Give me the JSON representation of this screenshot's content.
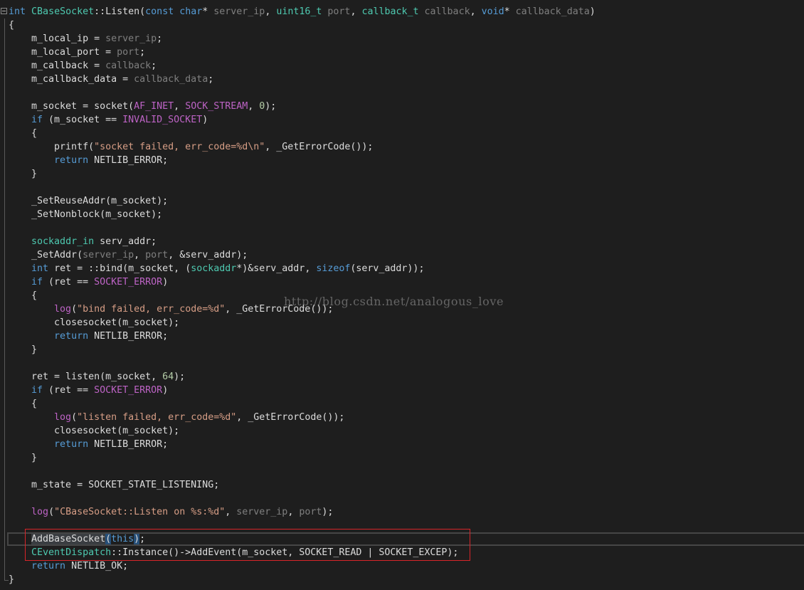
{
  "colors": {
    "background": "#1e1e1e",
    "default": "#dcdcdc",
    "keyword": "#569cd6",
    "type": "#4ec9b0",
    "macro": "#bd63c5",
    "string": "#d69d85",
    "parameter": "#7f7f7f",
    "number": "#b5cea8",
    "highlight_border": "#d8252a"
  },
  "editor": {
    "fold_icon": "collapse-icon",
    "watermark": "http://blog.csdn.net/analogous_love",
    "lines": [
      [
        {
          "t": "int",
          "c": "keyword"
        },
        {
          "t": " "
        },
        {
          "t": "CBaseSocket",
          "c": "type"
        },
        {
          "t": "::Listen("
        },
        {
          "t": "const",
          "c": "keyword"
        },
        {
          "t": " "
        },
        {
          "t": "char",
          "c": "keyword"
        },
        {
          "t": "* "
        },
        {
          "t": "server_ip",
          "c": "parameter"
        },
        {
          "t": ", "
        },
        {
          "t": "uint16_t",
          "c": "type"
        },
        {
          "t": " "
        },
        {
          "t": "port",
          "c": "parameter"
        },
        {
          "t": ", "
        },
        {
          "t": "callback_t",
          "c": "type"
        },
        {
          "t": " "
        },
        {
          "t": "callback",
          "c": "parameter"
        },
        {
          "t": ", "
        },
        {
          "t": "void",
          "c": "keyword"
        },
        {
          "t": "* "
        },
        {
          "t": "callback_data",
          "c": "parameter"
        },
        {
          "t": ")"
        }
      ],
      [
        {
          "t": "{"
        }
      ],
      [
        {
          "t": "    m_local_ip = "
        },
        {
          "t": "server_ip",
          "c": "parameter"
        },
        {
          "t": ";"
        }
      ],
      [
        {
          "t": "    m_local_port = "
        },
        {
          "t": "port",
          "c": "parameter"
        },
        {
          "t": ";"
        }
      ],
      [
        {
          "t": "    m_callback = "
        },
        {
          "t": "callback",
          "c": "parameter"
        },
        {
          "t": ";"
        }
      ],
      [
        {
          "t": "    m_callback_data = "
        },
        {
          "t": "callback_data",
          "c": "parameter"
        },
        {
          "t": ";"
        }
      ],
      [],
      [
        {
          "t": "    m_socket = socket("
        },
        {
          "t": "AF_INET",
          "c": "macro"
        },
        {
          "t": ", "
        },
        {
          "t": "SOCK_STREAM",
          "c": "macro"
        },
        {
          "t": ", "
        },
        {
          "t": "0",
          "c": "number"
        },
        {
          "t": ");"
        }
      ],
      [
        {
          "t": "    "
        },
        {
          "t": "if",
          "c": "keyword"
        },
        {
          "t": " (m_socket == "
        },
        {
          "t": "INVALID_SOCKET",
          "c": "macro"
        },
        {
          "t": ")"
        }
      ],
      [
        {
          "t": "    {"
        }
      ],
      [
        {
          "t": "        printf("
        },
        {
          "t": "\"socket failed, err_code=%d\\n\"",
          "c": "string"
        },
        {
          "t": ", _GetErrorCode());"
        }
      ],
      [
        {
          "t": "        "
        },
        {
          "t": "return",
          "c": "keyword"
        },
        {
          "t": " NETLIB_ERROR;"
        }
      ],
      [
        {
          "t": "    }"
        }
      ],
      [],
      [
        {
          "t": "    _SetReuseAddr(m_socket);"
        }
      ],
      [
        {
          "t": "    _SetNonblock(m_socket);"
        }
      ],
      [],
      [
        {
          "t": "    "
        },
        {
          "t": "sockaddr_in",
          "c": "type"
        },
        {
          "t": " serv_addr;"
        }
      ],
      [
        {
          "t": "    _SetAddr("
        },
        {
          "t": "server_ip",
          "c": "parameter"
        },
        {
          "t": ", "
        },
        {
          "t": "port",
          "c": "parameter"
        },
        {
          "t": ", &serv_addr);"
        }
      ],
      [
        {
          "t": "    "
        },
        {
          "t": "int",
          "c": "keyword"
        },
        {
          "t": " ret = ::bind(m_socket, ("
        },
        {
          "t": "sockaddr",
          "c": "type"
        },
        {
          "t": "*)&serv_addr, "
        },
        {
          "t": "sizeof",
          "c": "keyword"
        },
        {
          "t": "(serv_addr));"
        }
      ],
      [
        {
          "t": "    "
        },
        {
          "t": "if",
          "c": "keyword"
        },
        {
          "t": " (ret == "
        },
        {
          "t": "SOCKET_ERROR",
          "c": "macro"
        },
        {
          "t": ")"
        }
      ],
      [
        {
          "t": "    {"
        }
      ],
      [
        {
          "t": "        "
        },
        {
          "t": "log",
          "c": "macro"
        },
        {
          "t": "("
        },
        {
          "t": "\"bind failed, err_code=%d\"",
          "c": "string"
        },
        {
          "t": ", _GetErrorCode());"
        }
      ],
      [
        {
          "t": "        closesocket(m_socket);"
        }
      ],
      [
        {
          "t": "        "
        },
        {
          "t": "return",
          "c": "keyword"
        },
        {
          "t": " NETLIB_ERROR;"
        }
      ],
      [
        {
          "t": "    }"
        }
      ],
      [],
      [
        {
          "t": "    ret = listen(m_socket, "
        },
        {
          "t": "64",
          "c": "number"
        },
        {
          "t": ");"
        }
      ],
      [
        {
          "t": "    "
        },
        {
          "t": "if",
          "c": "keyword"
        },
        {
          "t": " (ret == "
        },
        {
          "t": "SOCKET_ERROR",
          "c": "macro"
        },
        {
          "t": ")"
        }
      ],
      [
        {
          "t": "    {"
        }
      ],
      [
        {
          "t": "        "
        },
        {
          "t": "log",
          "c": "macro"
        },
        {
          "t": "("
        },
        {
          "t": "\"listen failed, err_code=%d\"",
          "c": "string"
        },
        {
          "t": ", _GetErrorCode());"
        }
      ],
      [
        {
          "t": "        closesocket(m_socket);"
        }
      ],
      [
        {
          "t": "        "
        },
        {
          "t": "return",
          "c": "keyword"
        },
        {
          "t": " NETLIB_ERROR;"
        }
      ],
      [
        {
          "t": "    }"
        }
      ],
      [],
      [
        {
          "t": "    m_state = SOCKET_STATE_LISTENING;"
        }
      ],
      [],
      [
        {
          "t": "    "
        },
        {
          "t": "log",
          "c": "macro"
        },
        {
          "t": "("
        },
        {
          "t": "\"CBaseSocket::Listen on %s:%d\"",
          "c": "string"
        },
        {
          "t": ", "
        },
        {
          "t": "server_ip",
          "c": "parameter"
        },
        {
          "t": ", "
        },
        {
          "t": "port",
          "c": "parameter"
        },
        {
          "t": ");"
        }
      ],
      [],
      [
        {
          "t": "    "
        },
        {
          "t": "AddBaseSocket",
          "s": "hl"
        },
        {
          "t": "(",
          "s": "sel"
        },
        {
          "t": "this",
          "c": "keyword"
        },
        {
          "t": ")",
          "s": "sel"
        },
        {
          "t": ";"
        }
      ],
      [
        {
          "t": "    "
        },
        {
          "t": "CEventDispatch",
          "c": "type"
        },
        {
          "t": "::Instance()->AddEvent(m_socket, SOCKET_READ | SOCKET_EXCEP);"
        }
      ],
      [
        {
          "t": "    "
        },
        {
          "t": "return",
          "c": "keyword"
        },
        {
          "t": " NETLIB_OK;"
        }
      ],
      [
        {
          "t": "}"
        }
      ]
    ]
  }
}
